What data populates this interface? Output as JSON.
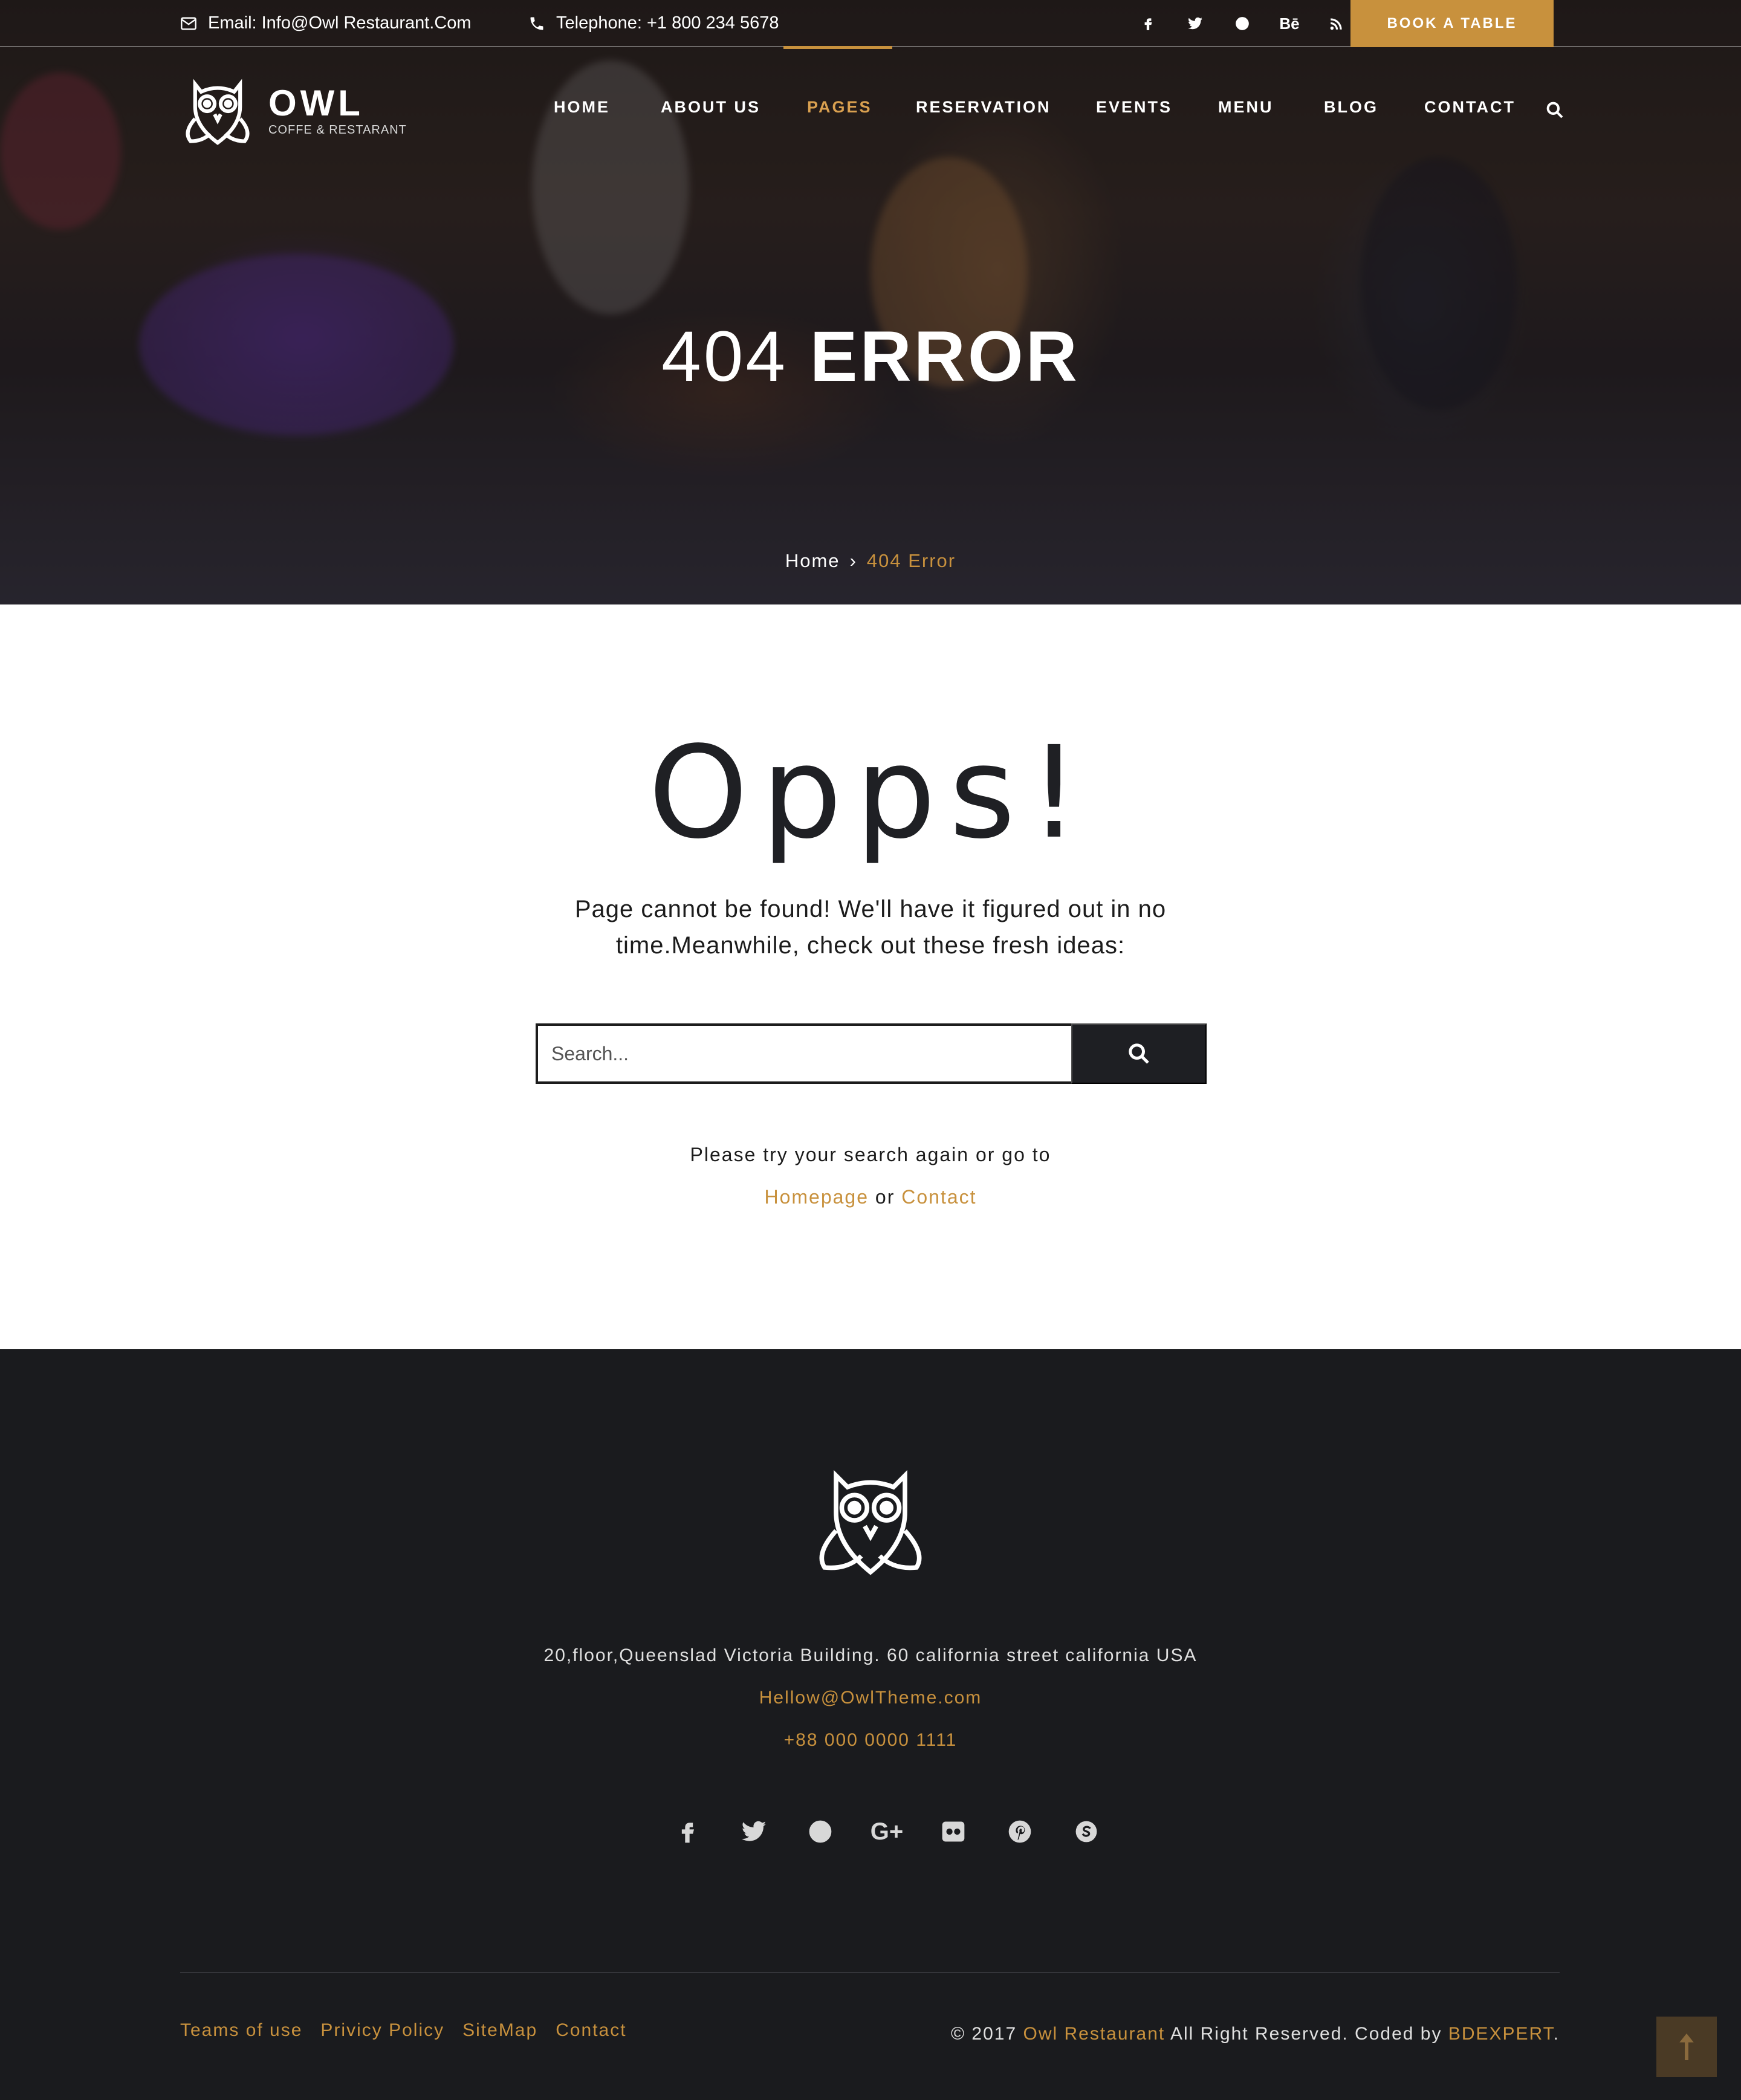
{
  "topbar": {
    "email_label": "Email: Info@Owl Restaurant.Com",
    "phone_label": "Telephone: +1 800 234 5678",
    "social": [
      "facebook-icon",
      "twitter-icon",
      "dribbble-icon",
      "behance-icon",
      "rss-icon"
    ],
    "behance_text": "Bē",
    "book_button": "BOOK A TABLE"
  },
  "brand": {
    "name": "OWL",
    "tagline": "COFFE & RESTARANT"
  },
  "nav": {
    "items": [
      "HOME",
      "ABOUT US",
      "PAGES",
      "RESERVATION",
      "EVENTS",
      "MENU",
      "BLOG",
      "CONTACT"
    ],
    "active": "PAGES"
  },
  "hero": {
    "title_light": "404",
    "title_bold": "ERROR",
    "breadcrumb_home": "Home",
    "breadcrumb_sep": "›",
    "breadcrumb_current": "404 Error"
  },
  "main": {
    "heading": "Opps!",
    "message": "Page cannot be found! We'll have it figured out in no time.Meanwhile, check out these fresh ideas:",
    "search_placeholder": "Search...",
    "try_again": "Please try your search again or go to",
    "homepage_link": "Homepage",
    "or_text": "or",
    "contact_link": "Contact"
  },
  "footer": {
    "address": "20,floor,Queenslad Victoria Building. 60 california street california USA",
    "email": "Hellow@OwlTheme.com",
    "phone": "+88 000 0000 1111",
    "social": [
      "facebook-icon",
      "twitter-icon",
      "dribbble-icon",
      "google-plus-icon",
      "flickr-icon",
      "pinterest-icon",
      "skype-icon"
    ],
    "google_plus_text": "G+",
    "links": [
      "Teams of use",
      "Privicy Policy",
      "SiteMap",
      "Contact"
    ],
    "copyright_prefix": "© 2017",
    "copyright_brand": "Owl Restaurant",
    "copyright_middle": "All Right Reserved. Coded by",
    "copyright_author": "BDEXPERT",
    "copyright_end": "."
  },
  "colors": {
    "accent": "#c8913d",
    "footer_bg": "#1a1b1e",
    "dark_button": "#1e1f23"
  }
}
